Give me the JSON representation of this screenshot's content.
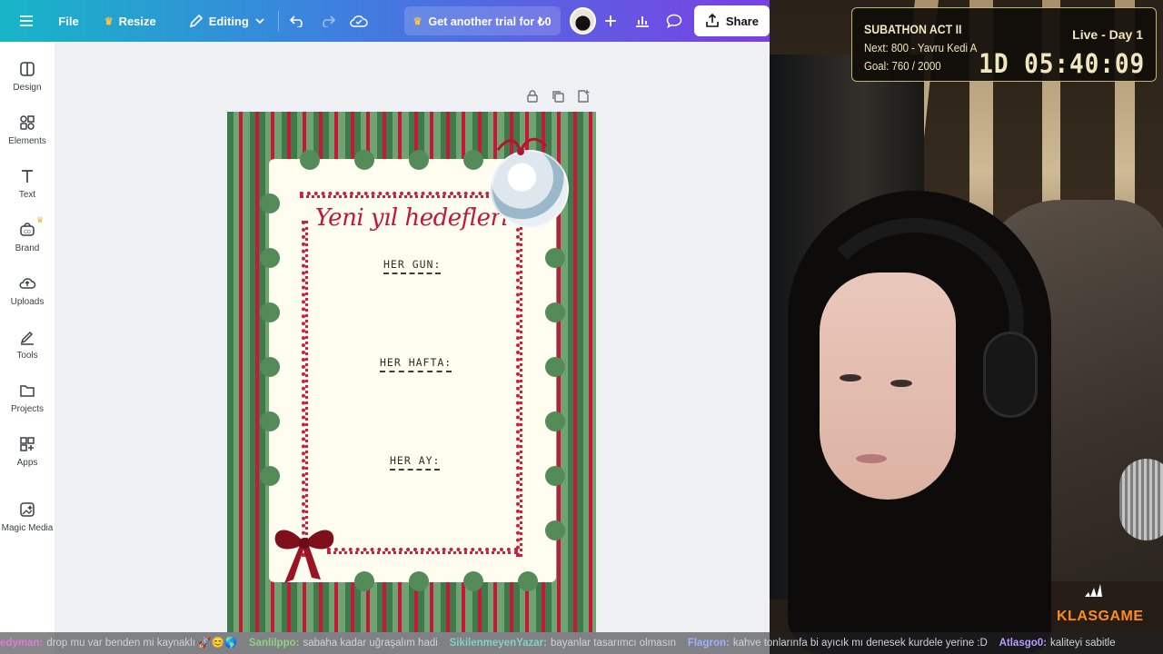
{
  "topbar": {
    "file_label": "File",
    "resize_label": "Resize",
    "editing_label": "Editing",
    "trial_label": "Get another trial for ₺0",
    "share_label": "Share"
  },
  "sidebar": {
    "items": [
      {
        "label": "Design",
        "icon": "design-icon"
      },
      {
        "label": "Elements",
        "icon": "elements-icon"
      },
      {
        "label": "Text",
        "icon": "text-icon"
      },
      {
        "label": "Brand",
        "icon": "brand-icon"
      },
      {
        "label": "Uploads",
        "icon": "uploads-icon"
      },
      {
        "label": "Tools",
        "icon": "tools-icon"
      },
      {
        "label": "Projects",
        "icon": "projects-icon"
      },
      {
        "label": "Apps",
        "icon": "apps-icon"
      },
      {
        "label": "Magic Media",
        "icon": "magic-media-icon"
      }
    ]
  },
  "poster": {
    "title": "Yeni yıl hedefleri",
    "sections": [
      "HER GUN:",
      "HER HAFTA:",
      "HER AY:"
    ]
  },
  "stream_overlay": {
    "title": "SUBATHON ACT II",
    "live": "Live - Day 1",
    "next": "Next: 800 - Yavru Kedi A",
    "goal": "Goal: 760 / 2000",
    "timer": "1D 05:40:09"
  },
  "chat": [
    {
      "user": "edyman:",
      "text": "drop mu var benden mi kaynaklı 🚀😊🌎",
      "color": "#e07bd6"
    },
    {
      "user": "Sanlilppo:",
      "text": "sabaha kadar uğraşalım hadi",
      "color": "#8fd37f"
    },
    {
      "user": "SikilenmeyenYazar:",
      "text": "bayanlar tasarımcı olmasın",
      "color": "#7fd3c7"
    },
    {
      "user": "Flagron:",
      "text": "kahve tonlarınfa bi ayıcık mı denesek kurdele yerine :D",
      "color": "#9fb0ff"
    },
    {
      "user": "Atlasgo0:",
      "text": "kaliteyi sabitle",
      "color": "#b99bff"
    }
  ],
  "watermark": "KLASGAME",
  "colors": {
    "topbar_start": "#17b5c7",
    "topbar_end": "#7b3fe4",
    "poster_red": "#c0173a",
    "poster_green": "#3e7a4a",
    "overlay_gold": "#c7b26d"
  }
}
